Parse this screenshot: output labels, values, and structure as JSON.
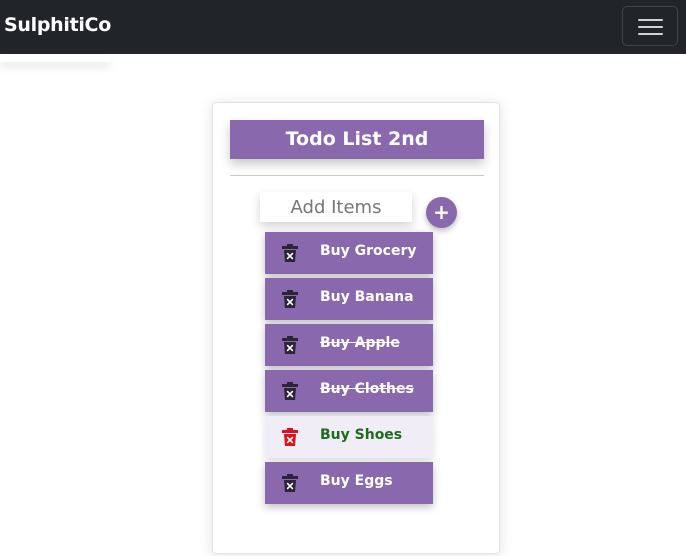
{
  "navbar": {
    "brand": "SulphitiCo",
    "toggle_icon": "hamburger-icon"
  },
  "todo": {
    "title": "Todo List 2nd",
    "add_placeholder": "Add Items",
    "add_button_label": "+",
    "items": [
      {
        "label": "Buy Grocery",
        "completed": false,
        "highlighted": false
      },
      {
        "label": "Buy Banana",
        "completed": false,
        "highlighted": false
      },
      {
        "label": "Buy Apple",
        "completed": true,
        "highlighted": false
      },
      {
        "label": "Buy Clothes",
        "completed": true,
        "highlighted": false
      },
      {
        "label": "Buy Shoes",
        "completed": false,
        "highlighted": true
      },
      {
        "label": "Buy Eggs",
        "completed": false,
        "highlighted": false
      }
    ]
  },
  "colors": {
    "navbar_bg": "#212529",
    "accent": "#8a68ad",
    "trash_icon": "#2c2538",
    "trash_icon_active": "#e0111b",
    "active_item_text": "#1d6b1d"
  }
}
